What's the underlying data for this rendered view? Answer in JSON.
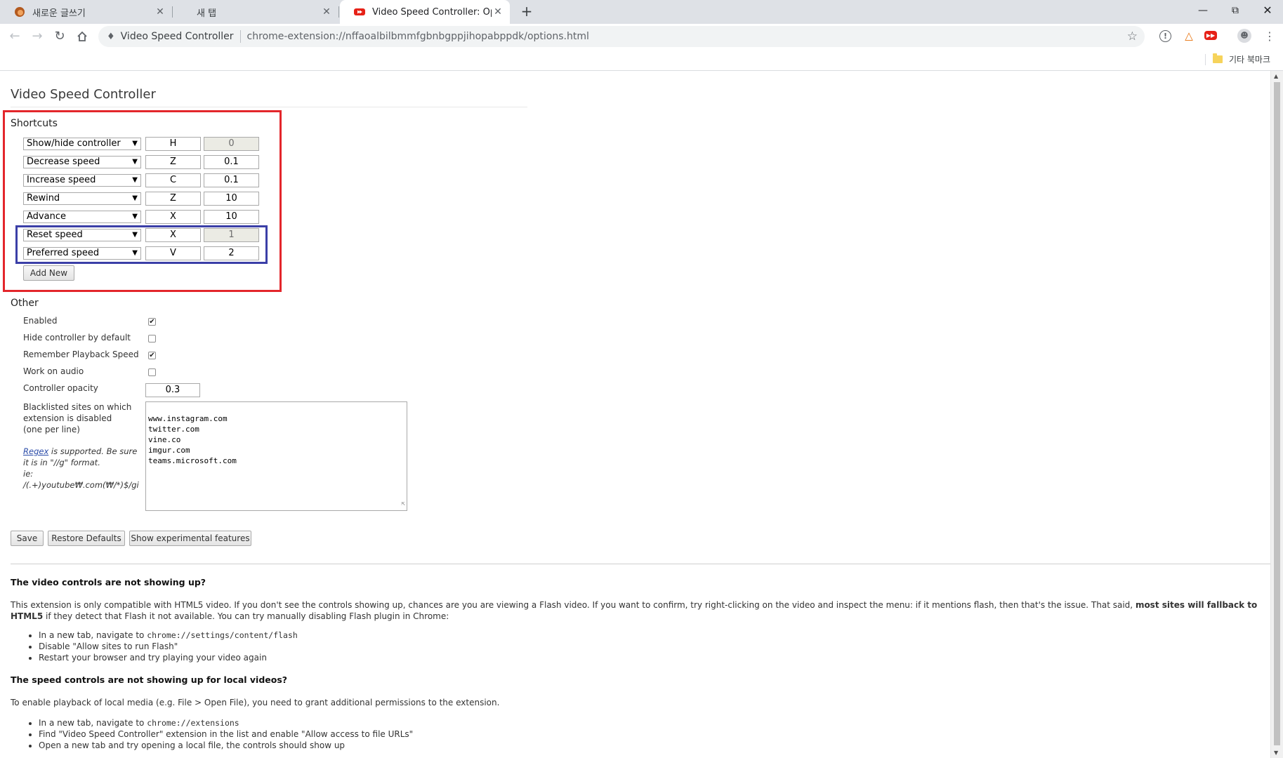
{
  "tabs": [
    {
      "title": "새로운 글쓰기",
      "icon": "hedgehog-icon",
      "active": false
    },
    {
      "title": "새 탭",
      "icon": "",
      "active": false
    },
    {
      "title": "Video Speed Controller: Options",
      "icon": "youtube-icon",
      "active": true
    }
  ],
  "toolbar": {
    "chip_label": "Video Speed Controller",
    "url": "chrome-extension://nffaoalbilbmmfgbnbgppjihopabppdk/options.html"
  },
  "bookmarks": {
    "folder_label": "기타 북마크"
  },
  "page": {
    "title": "Video Speed Controller",
    "shortcuts_title": "Shortcuts",
    "shortcuts": [
      {
        "action": "Show/hide controller",
        "key": "H",
        "value": "0",
        "value_disabled": true
      },
      {
        "action": "Decrease speed",
        "key": "Z",
        "value": "0.1",
        "value_disabled": false
      },
      {
        "action": "Increase speed",
        "key": "C",
        "value": "0.1",
        "value_disabled": false
      },
      {
        "action": "Rewind",
        "key": "Z",
        "value": "10",
        "value_disabled": false
      },
      {
        "action": "Advance",
        "key": "X",
        "value": "10",
        "value_disabled": false
      },
      {
        "action": "Reset speed",
        "key": "X",
        "value": "1",
        "value_disabled": true
      },
      {
        "action": "Preferred speed",
        "key": "V",
        "value": "2",
        "value_disabled": false
      }
    ],
    "add_new_label": "Add New",
    "other_title": "Other",
    "options": {
      "enabled": {
        "label": "Enabled",
        "checked": true
      },
      "hide_controller": {
        "label": "Hide controller by default",
        "checked": false
      },
      "remember_speed": {
        "label": "Remember Playback Speed",
        "checked": true
      },
      "work_on_audio": {
        "label": "Work on audio",
        "checked": false
      }
    },
    "opacity": {
      "label": "Controller opacity",
      "value": "0.3"
    },
    "blacklist": {
      "label_line1": "Blacklisted sites on which",
      "label_line2": "extension is disabled",
      "label_line3": "(one per line)",
      "sites": [
        "www.instagram.com",
        "twitter.com",
        "vine.co",
        "imgur.com",
        "teams.microsoft.com"
      ],
      "regex_link": "Regex",
      "regex_note": " is supported. Be sure it is in \"//g\" format.",
      "regex_example": "ie: /(.+)youtube₩.com(₩/*)$/gi"
    },
    "buttons": {
      "save": "Save",
      "restore": "Restore Defaults",
      "experimental": "Show experimental features"
    }
  },
  "faq": {
    "q1": "The video controls are not showing up?",
    "p1_before": "This extension is only compatible with HTML5 video. If you don't see the controls showing up, chances are you are viewing a Flash video. If you want to confirm, try right-clicking on the video and inspect the menu: if it mentions flash, then that's the issue. That said, ",
    "p1_bold": "most sites will fallback to HTML5",
    "p1_after": " if they detect that Flash it not available. You can try manually disabling Flash plugin in Chrome:",
    "list1": [
      {
        "text": "In a new tab, navigate to ",
        "code": "chrome://settings/content/flash"
      },
      {
        "text": "Disable \"Allow sites to run Flash\"",
        "code": ""
      },
      {
        "text": "Restart your browser and try playing your video again",
        "code": ""
      }
    ],
    "q2": "The speed controls are not showing up for local videos?",
    "p2": "To enable playback of local media (e.g. File > Open File), you need to grant additional permissions to the extension.",
    "list2": [
      {
        "text": "In a new tab, navigate to ",
        "code": "chrome://extensions"
      },
      {
        "text": "Find \"Video Speed Controller\" extension in the list and enable \"Allow access to file URLs\"",
        "code": ""
      },
      {
        "text": "Open a new tab and try opening a local file, the controls should show up",
        "code": ""
      }
    ]
  }
}
